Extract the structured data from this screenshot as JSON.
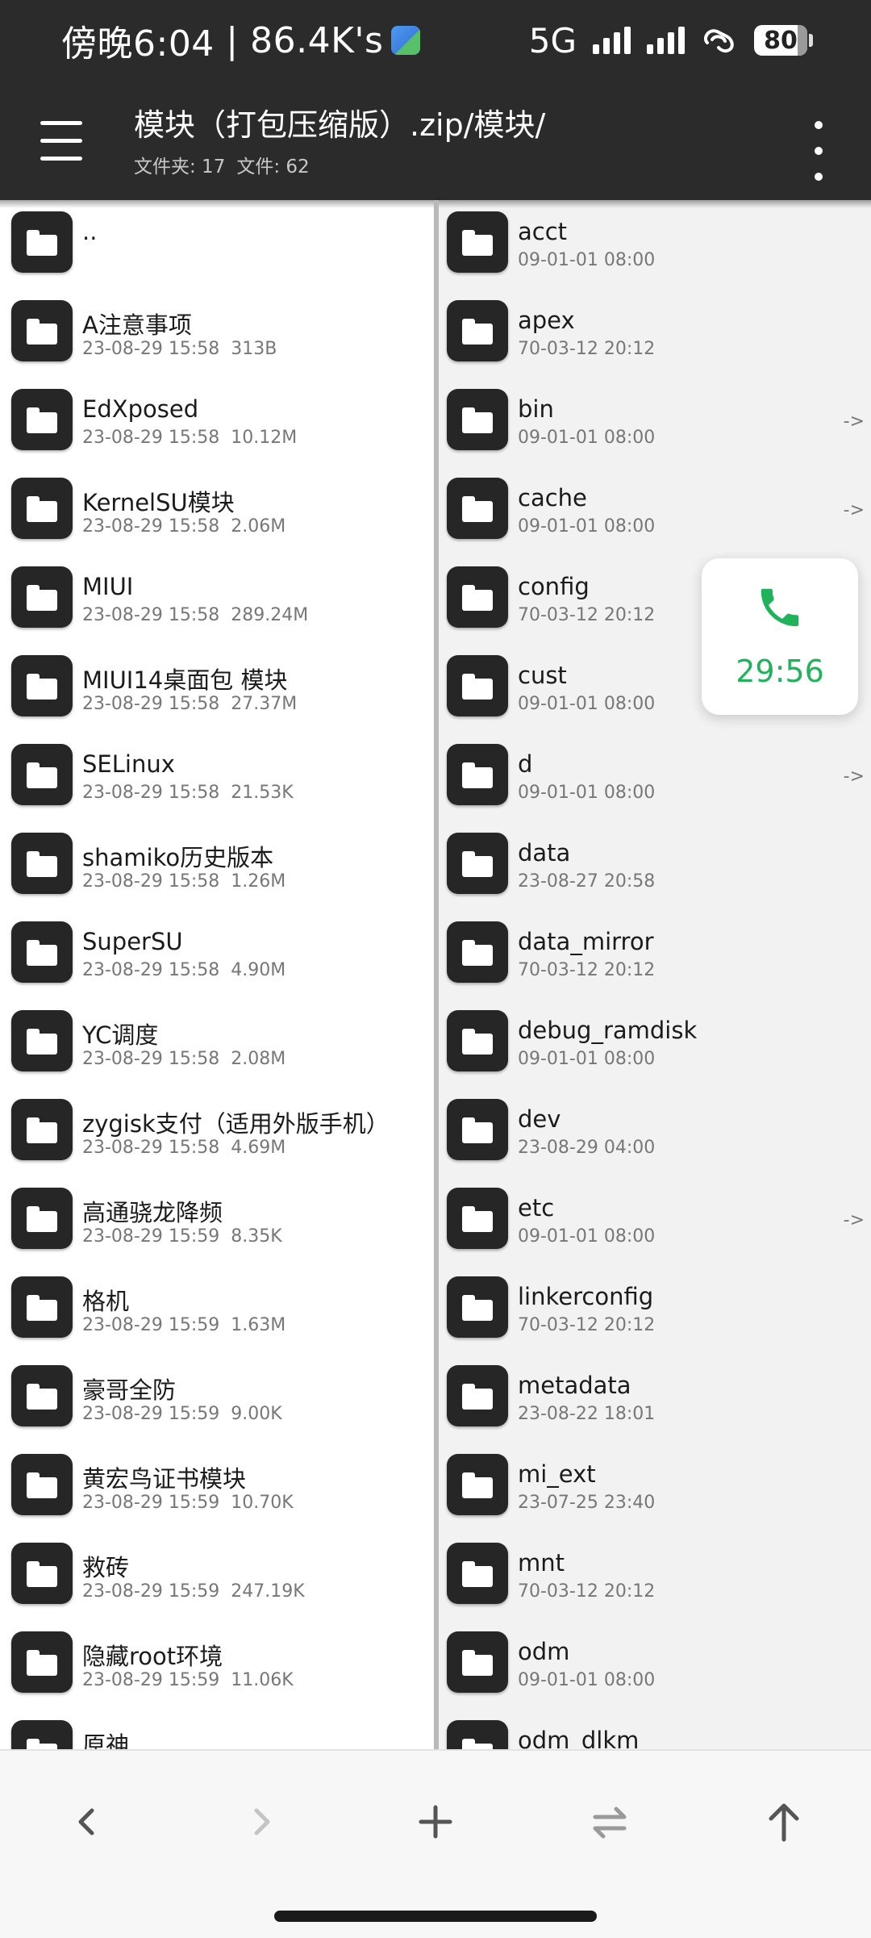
{
  "status_bar": {
    "time": "傍晚6:04",
    "net_speed": "86.4K's",
    "network": "5G",
    "battery": "80",
    "app_icon": "weather-app-icon"
  },
  "header": {
    "title": "模块（打包压缩版）.zip/模块/",
    "folders_label": "文件夹: 17",
    "files_label": "文件: 62",
    "menu_icon": "hamburger-menu-icon",
    "overflow_icon": "vertical-dots-icon"
  },
  "left_pane": {
    "items": [
      {
        "name": "..",
        "date": "",
        "size": ""
      },
      {
        "name": "A注意事项",
        "date": "23-08-29 15:58",
        "size": "313B"
      },
      {
        "name": "EdXposed",
        "date": "23-08-29 15:58",
        "size": "10.12M"
      },
      {
        "name": "KernelSU模块",
        "date": "23-08-29 15:58",
        "size": "2.06M"
      },
      {
        "name": "MIUI",
        "date": "23-08-29 15:58",
        "size": "289.24M"
      },
      {
        "name": "MIUI14桌面包 模块",
        "date": "23-08-29 15:58",
        "size": "27.37M"
      },
      {
        "name": "SELinux",
        "date": "23-08-29 15:58",
        "size": "21.53K"
      },
      {
        "name": "shamiko历史版本",
        "date": "23-08-29 15:58",
        "size": "1.26M"
      },
      {
        "name": "SuperSU",
        "date": "23-08-29 15:58",
        "size": "4.90M"
      },
      {
        "name": "YC调度",
        "date": "23-08-29 15:58",
        "size": "2.08M"
      },
      {
        "name": "zygisk支付（适用外版手机）",
        "date": "23-08-29 15:58",
        "size": "4.69M"
      },
      {
        "name": "高通骁龙降频",
        "date": "23-08-29 15:59",
        "size": "8.35K"
      },
      {
        "name": "格机",
        "date": "23-08-29 15:59",
        "size": "1.63M"
      },
      {
        "name": "豪哥全防",
        "date": "23-08-29 15:59",
        "size": "9.00K"
      },
      {
        "name": "黄宏鸟证书模块",
        "date": "23-08-29 15:59",
        "size": "10.70K"
      },
      {
        "name": "救砖",
        "date": "23-08-29 15:59",
        "size": "247.19K"
      },
      {
        "name": "隐藏root环境",
        "date": "23-08-29 15:59",
        "size": "11.06K"
      },
      {
        "name": "原神",
        "date": "",
        "size": ""
      }
    ]
  },
  "right_pane": {
    "items": [
      {
        "name": "acct",
        "date": "09-01-01 08:00",
        "link": ""
      },
      {
        "name": "apex",
        "date": "70-03-12 20:12",
        "link": ""
      },
      {
        "name": "bin",
        "date": "09-01-01 08:00",
        "link": "->"
      },
      {
        "name": "cache",
        "date": "09-01-01 08:00",
        "link": "->"
      },
      {
        "name": "config",
        "date": "70-03-12 20:12",
        "link": ""
      },
      {
        "name": "cust",
        "date": "09-01-01 08:00",
        "link": ""
      },
      {
        "name": "d",
        "date": "09-01-01 08:00",
        "link": "->"
      },
      {
        "name": "data",
        "date": "23-08-27 20:58",
        "link": ""
      },
      {
        "name": "data_mirror",
        "date": "70-03-12 20:12",
        "link": ""
      },
      {
        "name": "debug_ramdisk",
        "date": "09-01-01 08:00",
        "link": ""
      },
      {
        "name": "dev",
        "date": "23-08-29 04:00",
        "link": ""
      },
      {
        "name": "etc",
        "date": "09-01-01 08:00",
        "link": "->"
      },
      {
        "name": "linkerconfig",
        "date": "70-03-12 20:12",
        "link": ""
      },
      {
        "name": "metadata",
        "date": "23-08-22 18:01",
        "link": ""
      },
      {
        "name": "mi_ext",
        "date": "23-07-25 23:40",
        "link": ""
      },
      {
        "name": "mnt",
        "date": "70-03-12 20:12",
        "link": ""
      },
      {
        "name": "odm",
        "date": "09-01-01 08:00",
        "link": ""
      },
      {
        "name": "odm_dlkm",
        "date": "",
        "link": ""
      }
    ]
  },
  "call_overlay": {
    "duration": "29:56",
    "icon": "phone-icon",
    "color": "#20b35c"
  },
  "bottom_bar": {
    "buttons": [
      {
        "icon": "back-arrow-icon",
        "enabled": true
      },
      {
        "icon": "forward-arrow-icon",
        "enabled": false
      },
      {
        "icon": "plus-icon",
        "enabled": true
      },
      {
        "icon": "swap-icon",
        "enabled": true
      },
      {
        "icon": "up-arrow-icon",
        "enabled": true
      }
    ]
  }
}
